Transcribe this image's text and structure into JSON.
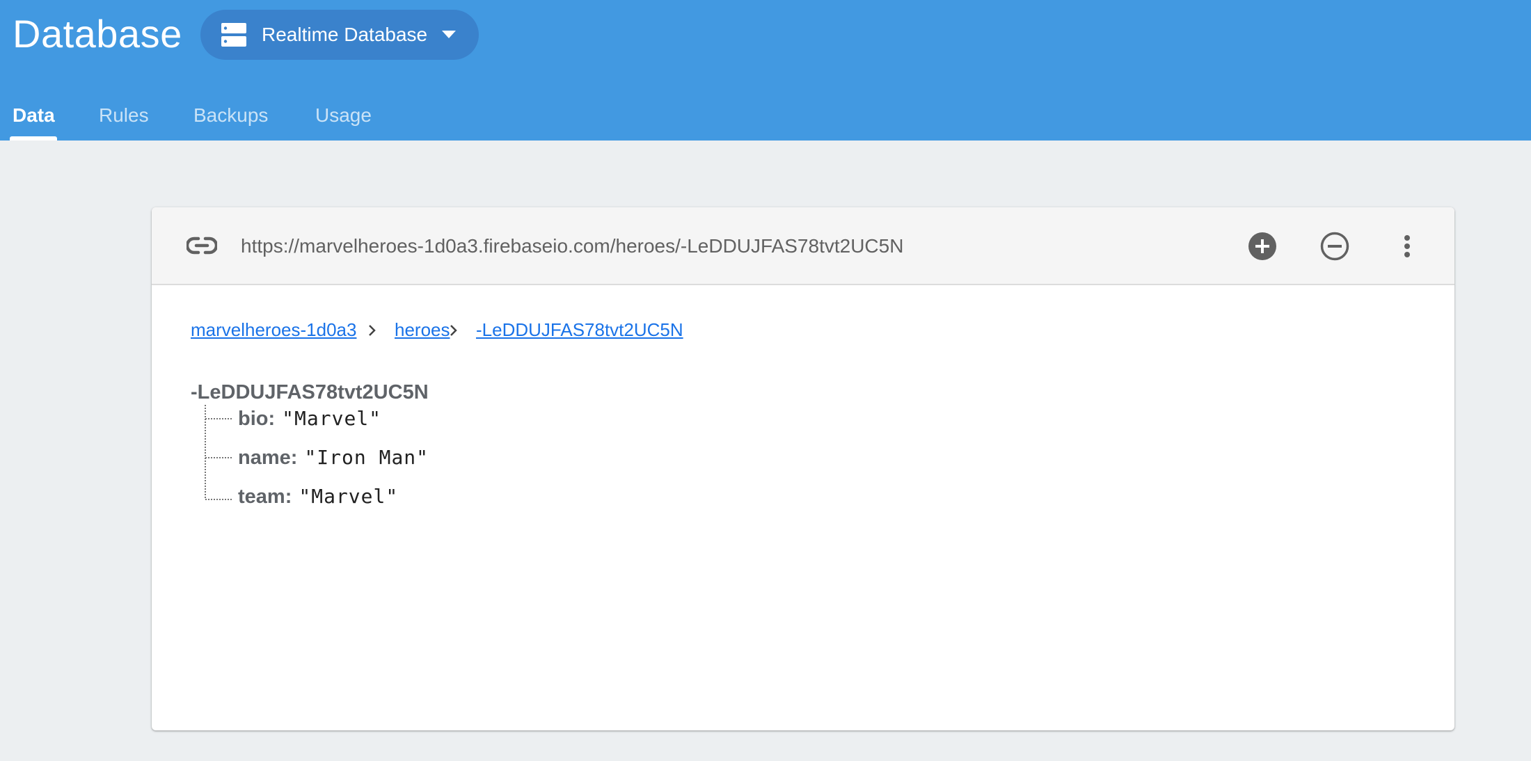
{
  "header": {
    "title": "Database",
    "db_selector_label": "Realtime Database",
    "tabs": [
      {
        "label": "Data",
        "active": true
      },
      {
        "label": "Rules",
        "active": false
      },
      {
        "label": "Backups",
        "active": false
      },
      {
        "label": "Usage",
        "active": false
      }
    ]
  },
  "toolbar": {
    "url": "https://marvelheroes-1d0a3.firebaseio.com/heroes/-LeDDUJFAS78tvt2UC5N",
    "icons": [
      "link-icon",
      "add-circle-icon",
      "remove-circle-icon",
      "more-vert-icon"
    ]
  },
  "breadcrumb": [
    "marvelheroes-1d0a3",
    "heroes",
    "-LeDDUJFAS78tvt2UC5N"
  ],
  "tree": {
    "root_key": "-LeDDUJFAS78tvt2UC5N",
    "children": [
      {
        "key": "bio",
        "value": "\"Marvel\""
      },
      {
        "key": "name",
        "value": "\"Iron Man\""
      },
      {
        "key": "team",
        "value": "\"Marvel\""
      }
    ]
  },
  "colors": {
    "header_bg": "#4299e1",
    "selector_bg": "#3a82cc",
    "page_bg": "#eceff1",
    "link": "#1a73e8"
  }
}
